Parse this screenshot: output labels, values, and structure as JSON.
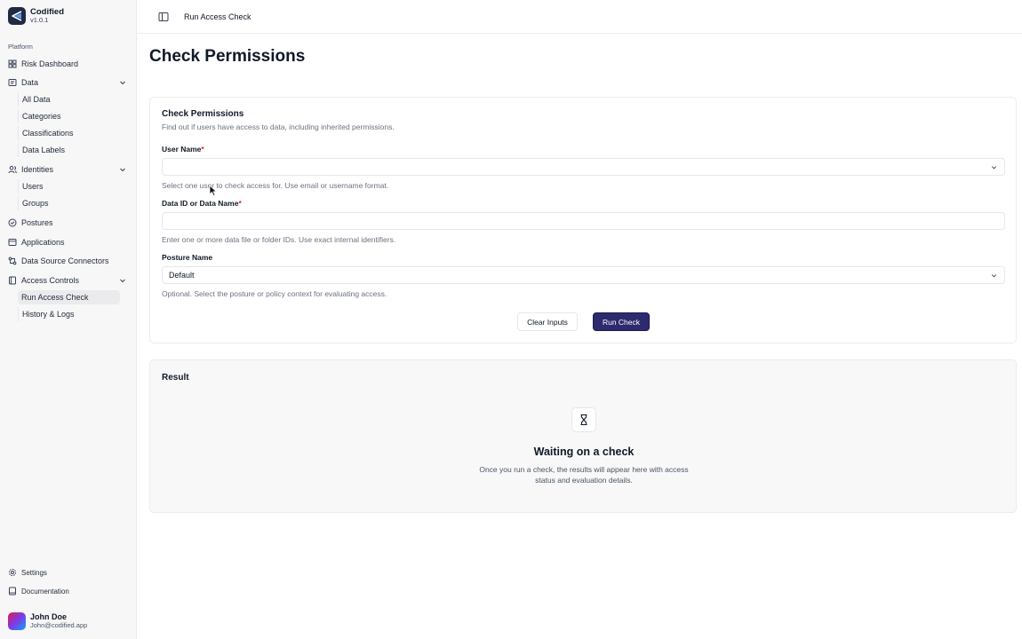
{
  "brand": {
    "name": "Codified",
    "version": "v1.0.1"
  },
  "sidebar": {
    "section_label": "Platform",
    "risk_dashboard": "Risk Dashboard",
    "data": {
      "label": "Data",
      "children": [
        "All Data",
        "Categories",
        "Classifications",
        "Data Labels"
      ]
    },
    "identities": {
      "label": "Identities",
      "children": [
        "Users",
        "Groups"
      ]
    },
    "postures": "Postures",
    "applications": "Applications",
    "data_source_connectors": "Data Source Connectors",
    "access_controls": {
      "label": "Access Controls",
      "children": [
        "Run Access Check",
        "History & Logs"
      ],
      "active": "Run Access Check"
    },
    "settings": "Settings",
    "documentation": "Documentation"
  },
  "user": {
    "name": "John Doe",
    "email": "John@codified.app"
  },
  "topbar": {
    "breadcrumb": "Run Access Check"
  },
  "page": {
    "title": "Check Permissions"
  },
  "form": {
    "title": "Check Permissions",
    "description": "Find out if users have access to data, including inherited permissions.",
    "user_name": {
      "label": "User Name",
      "required": "*",
      "value": "",
      "hint": "Select one user to check access for. Use email or username format."
    },
    "data_id": {
      "label": "Data ID or Data Name",
      "required": "*",
      "value": "",
      "hint": "Enter one or more data file or folder IDs. Use exact internal identifiers."
    },
    "posture": {
      "label": "Posture Name",
      "value": "Default",
      "hint": "Optional. Select the posture or policy context for evaluating access."
    },
    "clear_label": "Clear Inputs",
    "run_label": "Run Check"
  },
  "result": {
    "title": "Result",
    "waiting_title": "Waiting on a check",
    "waiting_desc": "Once you run a check, the results will appear here with access status and evaluation details."
  },
  "colors": {
    "accent": "#2e2a6e",
    "required": "#dc2626",
    "brand_bg": "#1f2a44"
  }
}
